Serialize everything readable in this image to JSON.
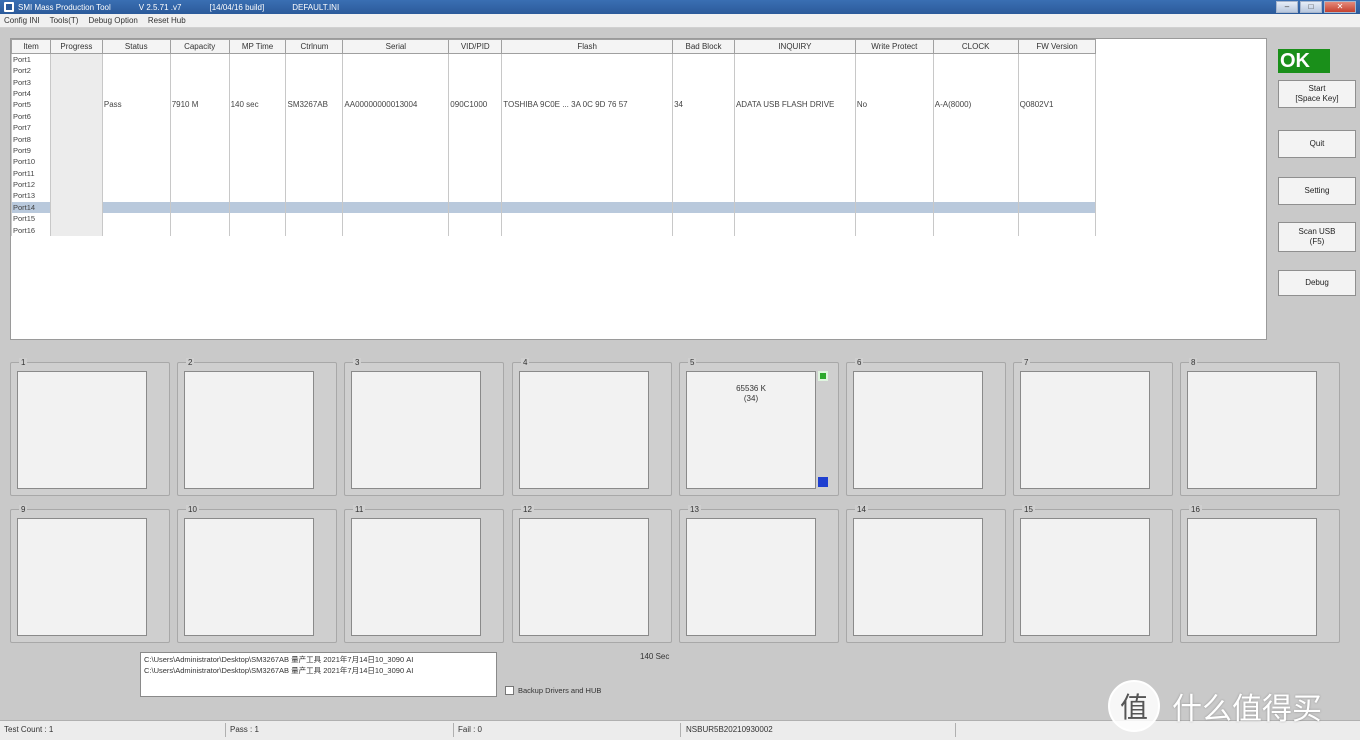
{
  "titlebar": {
    "app_title": "SMI Mass Production Tool",
    "version": "V 2.5.71 .v7",
    "build": "[14/04/16 build]",
    "config": "DEFAULT.INI",
    "controls": {
      "minimize": "–",
      "maximize": "□",
      "close": "✕"
    }
  },
  "menubar": {
    "items": [
      "Config INI",
      "Tools(T)",
      "Debug Option",
      "Reset Hub"
    ]
  },
  "grid": {
    "columns": [
      "Item",
      "Progress",
      "Status",
      "Capacity",
      "MP Time",
      "Ctrlnum",
      "Serial",
      "VID/PID",
      "Flash",
      "Bad Block",
      "INQUIRY",
      "Write Protect",
      "CLOCK",
      "FW Version"
    ],
    "ports": [
      "Port1",
      "Port2",
      "Port3",
      "Port4",
      "Port5",
      "Port6",
      "Port7",
      "Port8",
      "Port9",
      "Port10",
      "Port11",
      "Port12",
      "Port13",
      "Port14",
      "Port15",
      "Port16"
    ],
    "active_row": {
      "status": "Pass",
      "capacity": "7910 M",
      "mp_time": "140 sec",
      "ctrlnum": "SM3267AB",
      "serial": "AA00000000013004",
      "vidpid": "090C1000",
      "flash": "TOSHIBA 9C0E ... 3A 0C 9D 76 57",
      "bad_block": "34",
      "inquiry": "ADATA USB FLASH DRIVE",
      "write_protect": "No",
      "clock": "A-A(8000)",
      "fw_version": "Q0802V1"
    }
  },
  "ok_label": "OK",
  "buttons": {
    "start": "Start\n[Space Key]",
    "quit": "Quit",
    "setting": "Setting",
    "scan_usb": "Scan USB\n(F5)",
    "debug": "Debug"
  },
  "slots": [
    {
      "label": "1",
      "text": ""
    },
    {
      "label": "2",
      "text": ""
    },
    {
      "label": "3",
      "text": ""
    },
    {
      "label": "4",
      "text": ""
    },
    {
      "label": "5",
      "text": "65536 K\n(34)"
    },
    {
      "label": "6",
      "text": ""
    },
    {
      "label": "7",
      "text": ""
    },
    {
      "label": "8",
      "text": ""
    },
    {
      "label": "9",
      "text": ""
    },
    {
      "label": "10",
      "text": ""
    },
    {
      "label": "11",
      "text": ""
    },
    {
      "label": "12",
      "text": ""
    },
    {
      "label": "13",
      "text": ""
    },
    {
      "label": "14",
      "text": ""
    },
    {
      "label": "15",
      "text": ""
    },
    {
      "label": "16",
      "text": ""
    }
  ],
  "log_lines": [
    "C:\\Users\\Administrator\\Desktop\\SM3267AB 量产工具 2021年7月14日10_3090 AI",
    "C:\\Users\\Administrator\\Desktop\\SM3267AB 量产工具 2021年7月14日10_3090 AI"
  ],
  "time_text": "140 Sec",
  "checkbox_label": "Backup Drivers and HUB",
  "statusbar": {
    "test_count": "Test Count : 1",
    "pass": "Pass : 1",
    "fail": "Fail : 0",
    "serial_code": "NSBUR5B20210930002"
  },
  "watermark": {
    "text": "什么值得买",
    "logo_char": "值"
  },
  "colors": {
    "ok_green": "#1a8f1a",
    "slot_green_icon": "#2ca82c",
    "slot_blue_icon": "#1e3fd0",
    "selected_row": "#b9c9dc"
  }
}
